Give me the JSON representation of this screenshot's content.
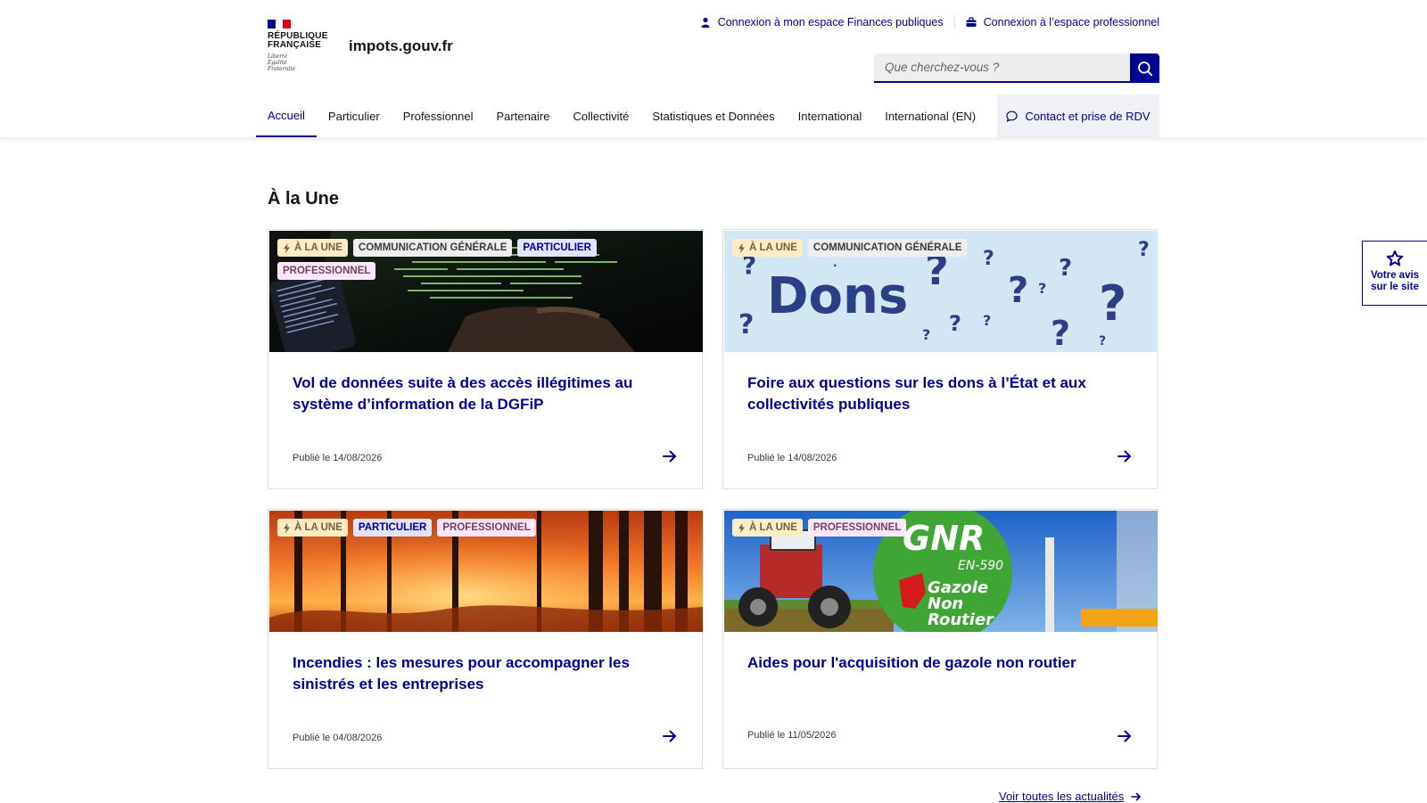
{
  "header": {
    "logo_lines": [
      "RÉPUBLIQUE",
      "FRANÇAISE"
    ],
    "devise": [
      "Liberté",
      "Égalité",
      "Fraternité"
    ],
    "site_name": "impots.gouv.fr",
    "top_links": [
      {
        "label": "Connexion à mon espace Finances publiques",
        "icon": "user-icon"
      },
      {
        "label": "Connexion à l’espace professionnel",
        "icon": "briefcase-icon"
      }
    ],
    "search": {
      "placeholder": "Que cherchez-vous ?",
      "icon": "search-icon"
    }
  },
  "nav": {
    "items": [
      "Accueil",
      "Particulier",
      "Professionnel",
      "Partenaire",
      "Collectivité",
      "Statistiques et Données",
      "International",
      "International (EN)"
    ],
    "active": "Accueil",
    "contact": {
      "label": "Contact et prise de RDV",
      "icon": "chat-icon"
    }
  },
  "section": {
    "title": "À la Une"
  },
  "cards": [
    {
      "badges": [
        "À LA UNE",
        "COMMUNICATION GÉNÉRALE",
        "PARTICULIER",
        "PROFESSIONNEL"
      ],
      "title": "Vol de données suite à des accès illégitimes au système d’information de la DGFiP",
      "date": "Publié le 14/08/2026"
    },
    {
      "badges": [
        "À LA UNE",
        "COMMUNICATION GÉNÉRALE"
      ],
      "image_text": "Dons",
      "title": "Foire aux questions sur les dons à l’État et aux collectivités publiques",
      "date": "Publié le 14/08/2026"
    },
    {
      "badges": [
        "À LA UNE",
        "PARTICULIER",
        "PROFESSIONNEL"
      ],
      "title": "Incendies : les mesures pour accompagner les sinistrés et les entreprises",
      "date": "Publié le 04/08/2026"
    },
    {
      "badges": [
        "À LA UNE",
        "PROFESSIONNEL"
      ],
      "image_text": {
        "main": "GNR",
        "sub": "EN-590",
        "lines": [
          "Gazole",
          "Non",
          "Routier"
        ]
      },
      "title": "Aides pour l'acquisition de gazole non routier",
      "date": "Publié le 11/05/2026"
    }
  ],
  "see_all": {
    "label": "Voir toutes les actualités",
    "icon": "arrow-right-icon"
  },
  "feedback": {
    "line1": "Votre avis",
    "line2": "sur le site",
    "icon": "star-icon"
  },
  "colors": {
    "primary": "#000091",
    "badge_une_bg": "#feecc2",
    "badge_une_fg": "#716043",
    "badge_com_bg": "#eeeeee",
    "badge_com_fg": "#3a3a3a",
    "badge_part_bg": "#e3e3fd",
    "badge_part_fg": "#000091",
    "badge_pro_bg": "#fee7fc",
    "badge_pro_fg": "#6e445a"
  }
}
